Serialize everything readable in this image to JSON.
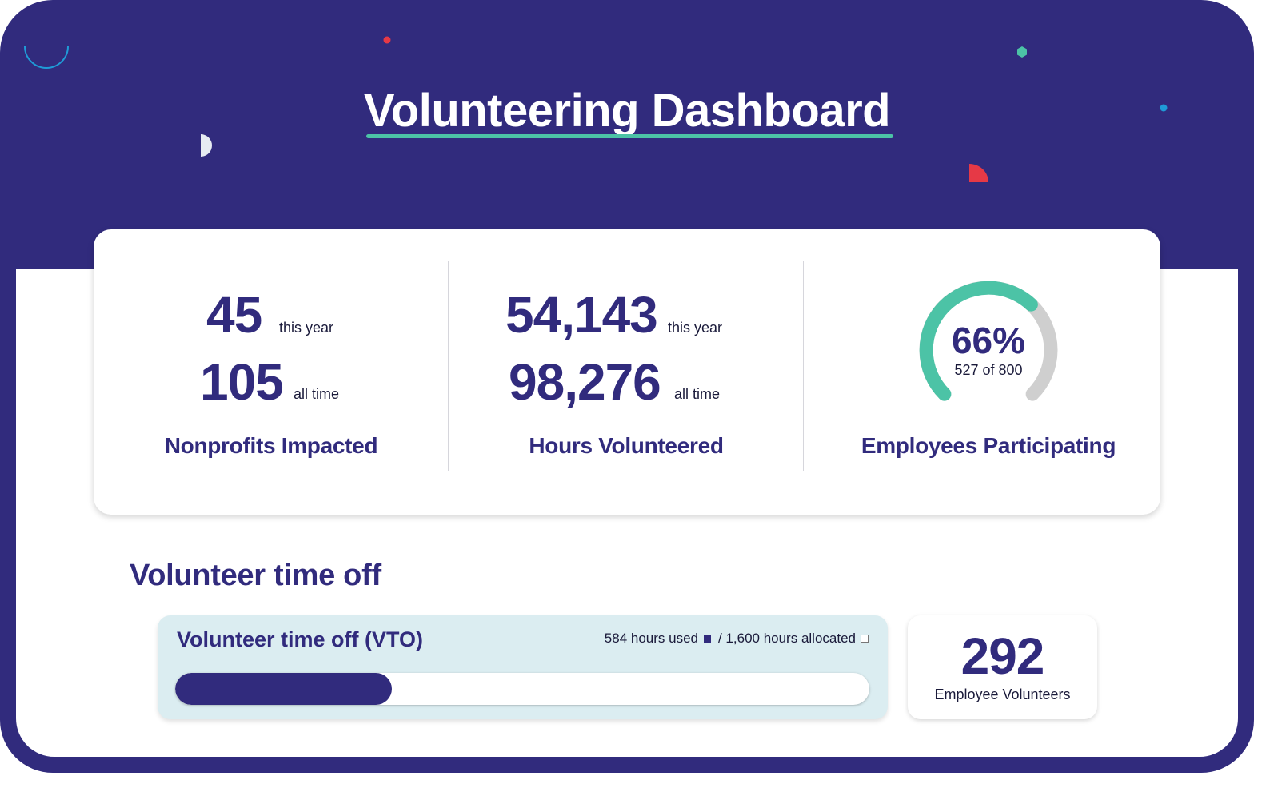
{
  "header": {
    "title": "Volunteering Dashboard"
  },
  "stats": {
    "nonprofits": {
      "this_year_value": "45",
      "this_year_label": "this year",
      "all_time_value": "105",
      "all_time_label": "all time",
      "label": "Nonprofits Impacted"
    },
    "hours": {
      "this_year_value": "54,143",
      "this_year_label": "this year",
      "all_time_value": "98,276",
      "all_time_label": "all time",
      "label": "Hours Volunteered"
    },
    "participation": {
      "percent_text": "66%",
      "detail": "527 of 800",
      "label": "Employees Participating",
      "fraction": 0.66
    }
  },
  "vto_section": {
    "title": "Volunteer time off",
    "card_title": "Volunteer time off (VTO)",
    "used_text": "584 hours used",
    "allocated_text": "/ 1,600 hours allocated",
    "used_fraction": 0.3125
  },
  "employee_volunteers": {
    "value": "292",
    "label": "Employee Volunteers"
  },
  "colors": {
    "navy": "#312b7d",
    "teal": "#4cc3a6",
    "gray": "#cfcfcf",
    "light_blue": "#dbedf1",
    "red": "#e63946",
    "sky": "#1f9bd7"
  }
}
